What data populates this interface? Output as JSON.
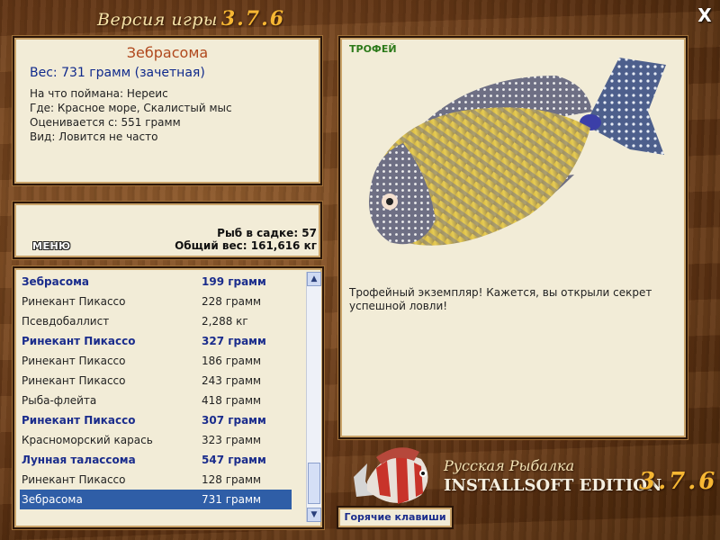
{
  "header": {
    "title": "Версия игры",
    "version": "3.7.6",
    "close": "X"
  },
  "catch": {
    "name": "Зебрасома",
    "weight": "Вес: 731 грамм (зачетная)",
    "details": [
      "На что поймана: Нереис",
      "Где: Красное море, Скалистый мыс",
      "Оценивается с: 551 грамм",
      "Вид: Ловится не часто"
    ]
  },
  "stats": {
    "fish_in_keepnet": "Рыб в садке: 57",
    "total_weight": "Общий вес: 161,616 кг",
    "menu_label": "МЕНЮ"
  },
  "fish_list": [
    {
      "name": "Зебрасома",
      "weight": "199 грамм",
      "bold": true
    },
    {
      "name": "Ринекант Пикассо",
      "weight": "228 грамм",
      "bold": false
    },
    {
      "name": "Псевдобаллист",
      "weight": "2,288 кг",
      "bold": false
    },
    {
      "name": "Ринекант Пикассо",
      "weight": "327 грамм",
      "bold": true
    },
    {
      "name": "Ринекант Пикассо",
      "weight": "186 грамм",
      "bold": false
    },
    {
      "name": "Ринекант Пикассо",
      "weight": "243 грамм",
      "bold": false
    },
    {
      "name": "Рыба-флейта",
      "weight": "418 грамм",
      "bold": false
    },
    {
      "name": "Ринекант Пикассо",
      "weight": "307 грамм",
      "bold": true
    },
    {
      "name": "Красноморский карась",
      "weight": "323 грамм",
      "bold": false
    },
    {
      "name": "Лунная талассома",
      "weight": "547 грамм",
      "bold": true
    },
    {
      "name": "Ринекант Пикассо",
      "weight": "128 грамм",
      "bold": false
    },
    {
      "name": "Зебрасома",
      "weight": "731 грамм",
      "bold": false,
      "selected": true
    }
  ],
  "trophy": {
    "label": "ТРОФЕЙ",
    "description": "Трофейный экземпляр! Кажется, вы открыли секрет успешной ловли!"
  },
  "logo": {
    "line1": "Русская Рыбалка",
    "line2": "INSTALLSOFT EDITION",
    "version": "3.7.6"
  },
  "hotkeys_label": "Горячие клавиши",
  "colors": {
    "bold_entry": "#1a2c8c",
    "selected_bg": "#2f5ea7",
    "fish_name": "#b0481d",
    "accent_version": "#f7b733"
  }
}
